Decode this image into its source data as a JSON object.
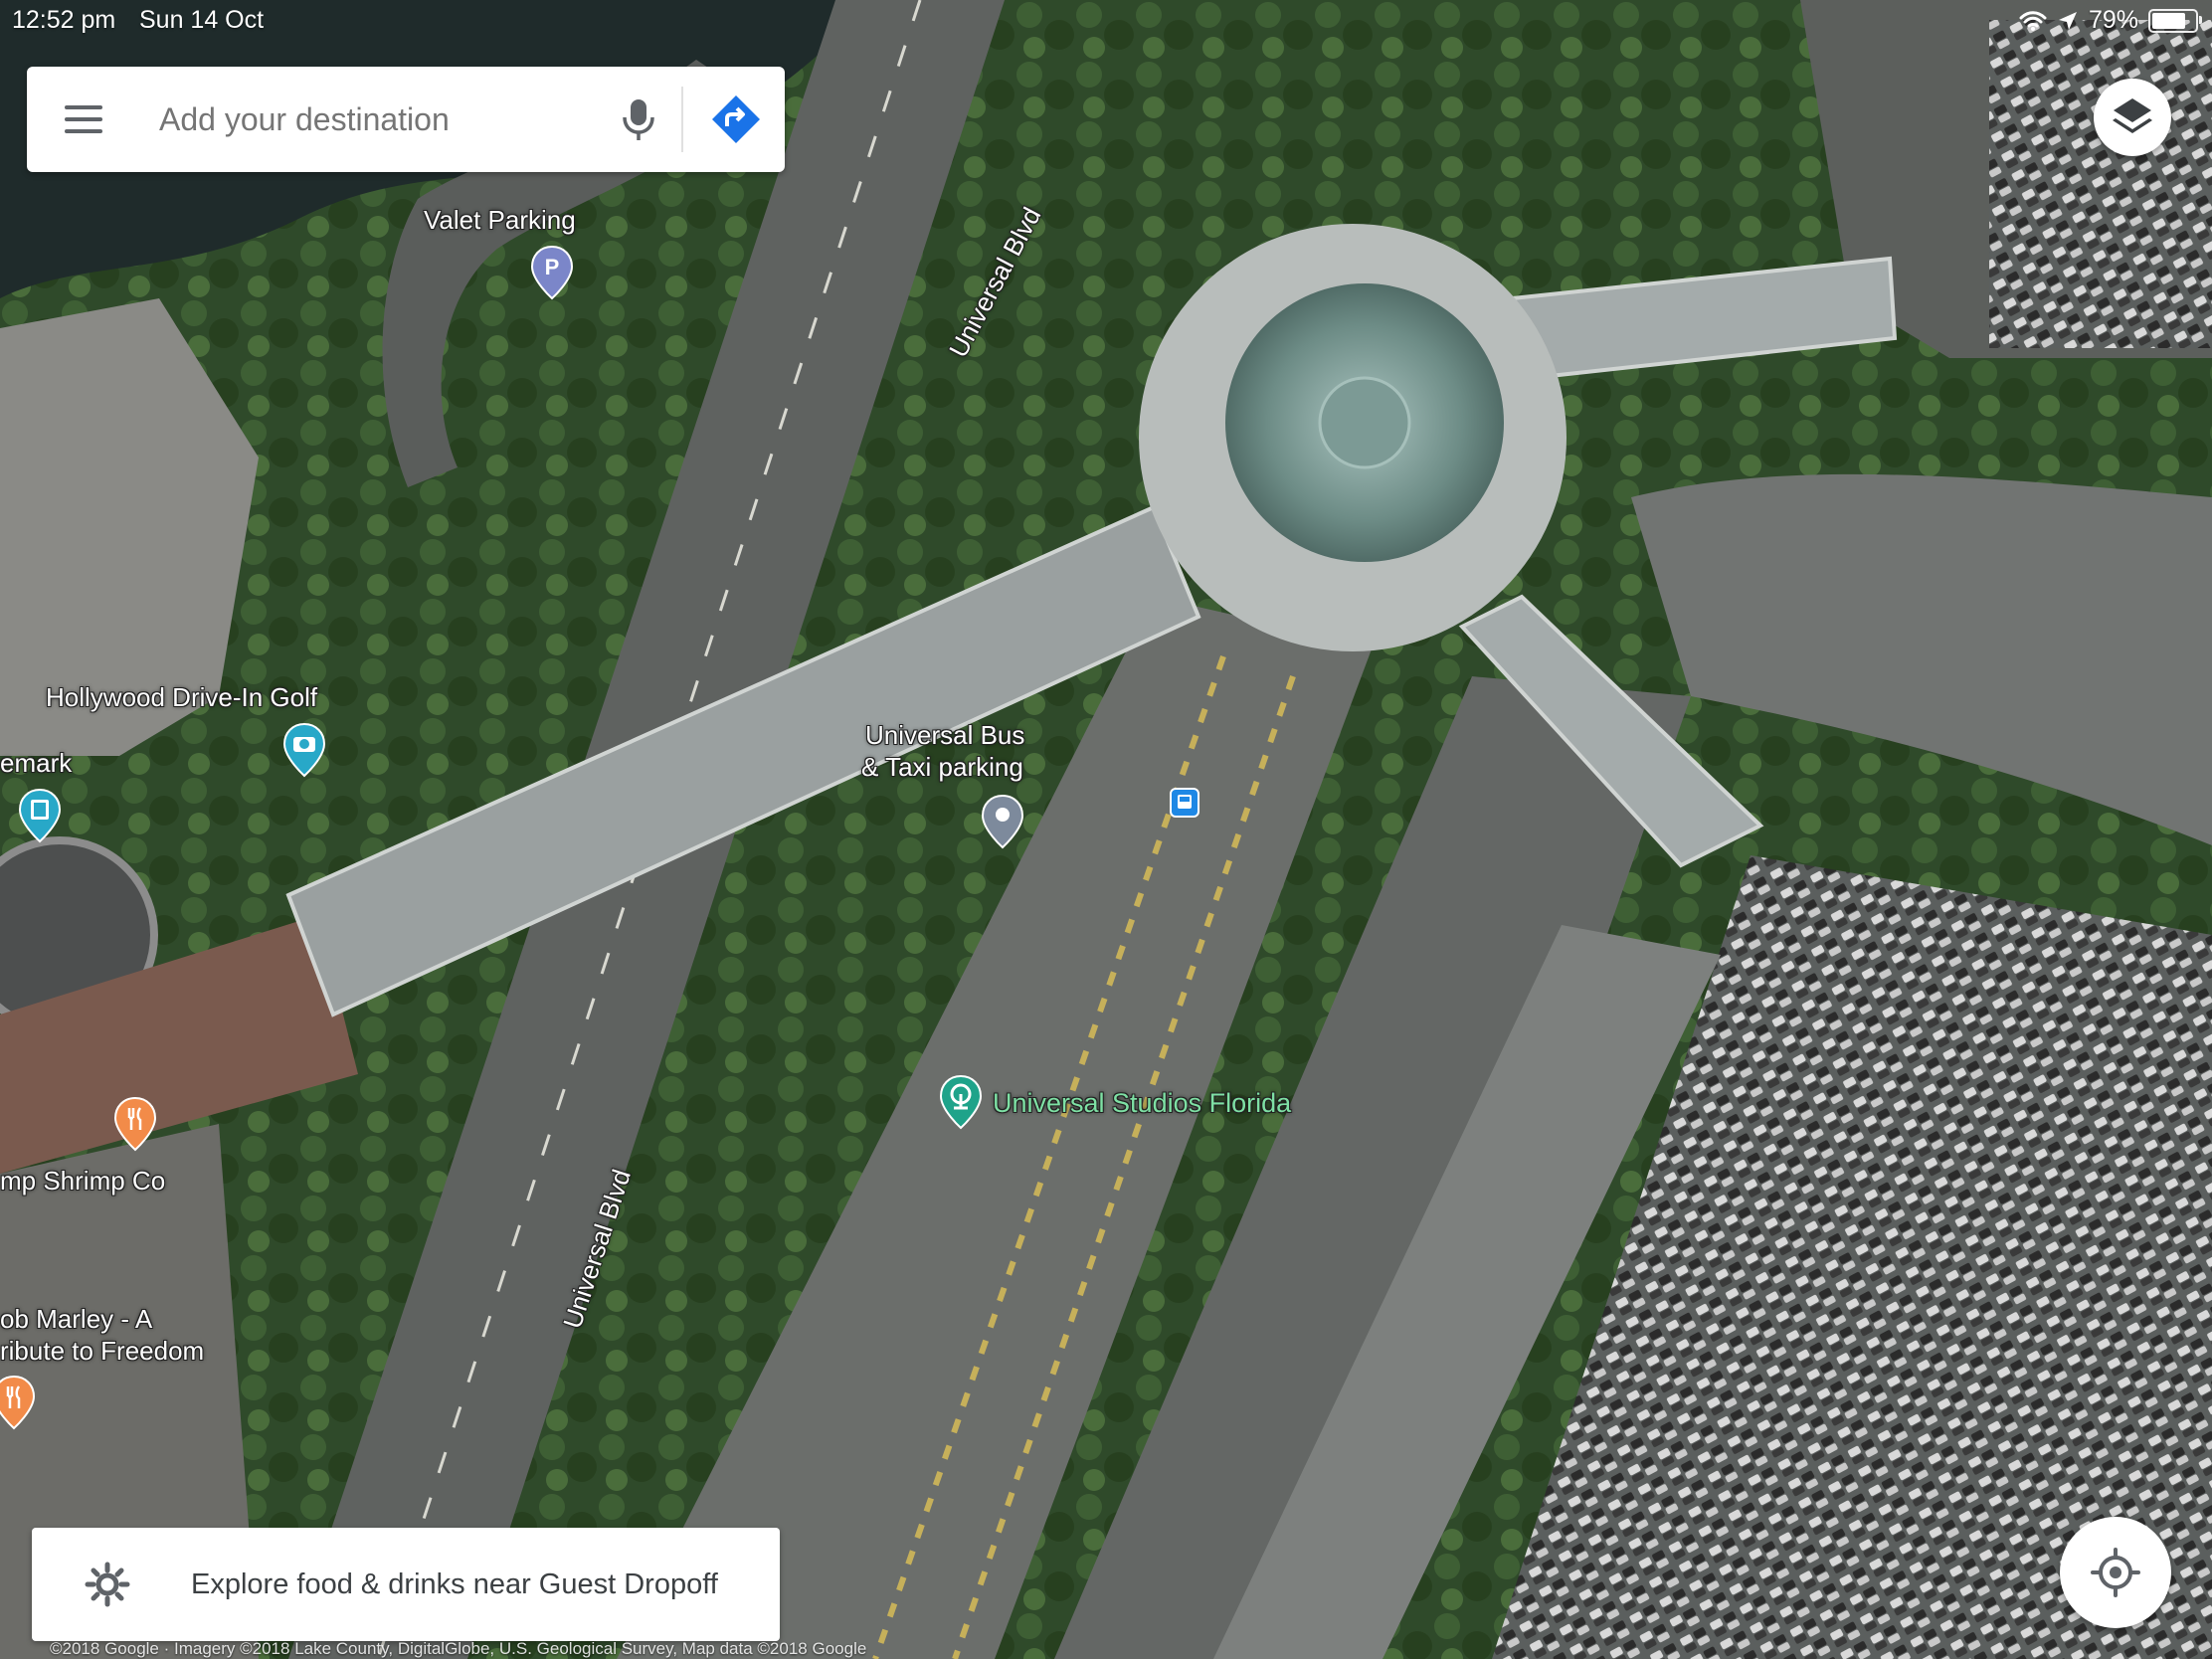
{
  "status_bar": {
    "time": "12:52 pm",
    "date": "Sun 14 Oct",
    "battery_percent": "79%",
    "battery_level": 0.79
  },
  "search": {
    "placeholder": "Add your destination"
  },
  "labels": {
    "valet_parking": "Valet Parking",
    "universal_blvd_top": "Universal Blvd",
    "universal_blvd_bottom": "Universal Blvd",
    "hollywood_golf": "Hollywood Drive-In Golf",
    "bus_taxi_line1": "Universal Bus",
    "bus_taxi_line2": "& Taxi parking",
    "emark": "emark",
    "universal_studios": "Universal Studios Florida",
    "shrimp_co": "mp Shrimp Co",
    "bob_marley_line1": "ob Marley - A",
    "bob_marley_line2": "ribute to Freedom"
  },
  "icons": {
    "menu": "menu-icon",
    "mic": "microphone-icon",
    "directions": "directions-icon",
    "layers": "layers-icon",
    "locate": "my-location-icon",
    "explore": "explore-icon",
    "parking": "parking-pin-icon",
    "camera": "camera-pin-icon",
    "film": "film-pin-icon",
    "place": "place-pin-icon",
    "bus": "bus-stop-icon",
    "park": "theme-park-pin-icon",
    "restaurant": "restaurant-pin-icon"
  },
  "explore": {
    "label": "Explore food & drinks near Guest Dropoff"
  },
  "copyright": "©2018 Google · Imagery ©2018 Lake County, DigitalGlobe, U.S. Geological Survey, Map data ©2018 Google",
  "colors": {
    "accent_blue": "#1a73e8",
    "park_green": "#7ee0a4",
    "parking_pin": "#7b86c9",
    "food_pin": "#f28b49",
    "film_pin": "#28a8c8"
  }
}
